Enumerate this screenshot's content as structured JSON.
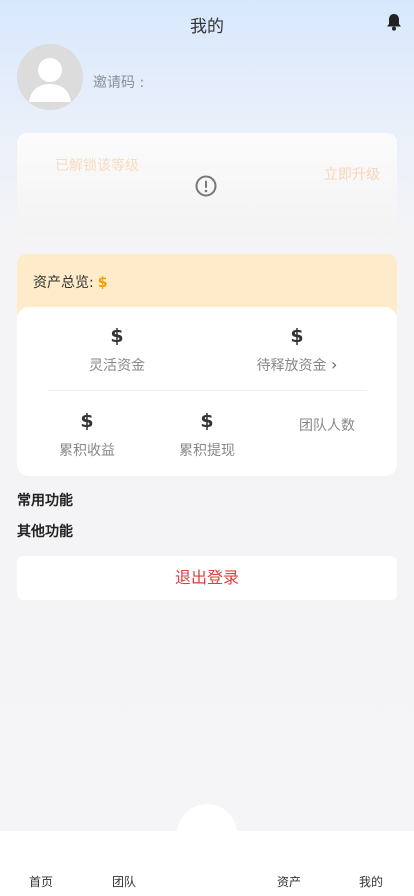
{
  "header": {
    "title": "我的",
    "bell_icon": "bell-icon"
  },
  "profile": {
    "invite_label": "邀请码 :",
    "avatar_icon": "user-avatar-icon"
  },
  "level": {
    "unlocked_label": "已解锁该等级",
    "upgrade_label": "立即升级",
    "warning_icon": "exclamation-circle-icon"
  },
  "assets": {
    "overview_label": "资产总览:",
    "overview_value": "$",
    "flexible_value": "$",
    "flexible_label": "灵活资金",
    "pending_value": "$",
    "pending_label": "待释放资金",
    "pending_chevron": "›",
    "earnings_value": "$",
    "earnings_label": "累积收益",
    "withdrawn_value": "$",
    "withdrawn_label": "累积提现",
    "team_label": "团队人数"
  },
  "sections": {
    "common": "常用功能",
    "other": "其他功能"
  },
  "logout": {
    "label": "退出登录"
  },
  "tabs": {
    "home": "首页",
    "team": "团队",
    "assets": "资产",
    "mine": "我的"
  },
  "colors": {
    "accent_orange": "#f0a100",
    "logout_red": "#d9413a",
    "asset_header_bg": "#fdebc9"
  }
}
